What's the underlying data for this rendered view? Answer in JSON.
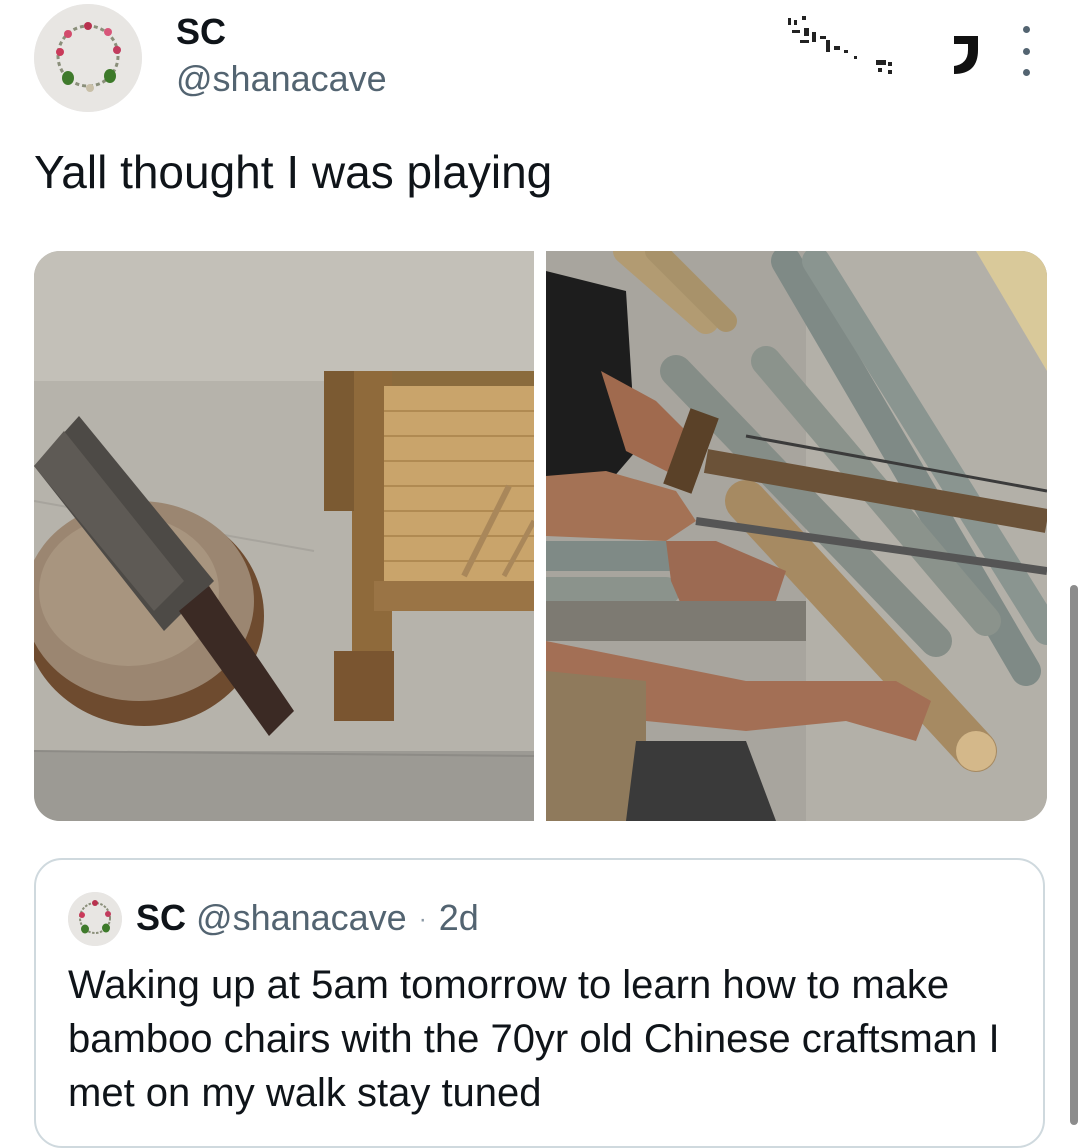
{
  "author": {
    "name": "SC",
    "handle": "@shanacave"
  },
  "tweet": {
    "text": "Yall thought I was playing"
  },
  "media": {
    "icon_left": "bamboo-chair-and-knife-photo",
    "icon_right": "sawing-bamboo-photo"
  },
  "quote": {
    "name": "SC",
    "handle": "@shanacave",
    "separator": "·",
    "time": "2d",
    "text": "Waking up at 5am tomorrow to learn how to make bamboo chairs with the 70yr old Chinese craftsman I met on my walk stay tuned"
  },
  "icons": {
    "more": "more-dots-icon"
  },
  "colors": {
    "text_primary": "#0f1419",
    "text_secondary": "#536471",
    "border": "#cfd9de"
  }
}
